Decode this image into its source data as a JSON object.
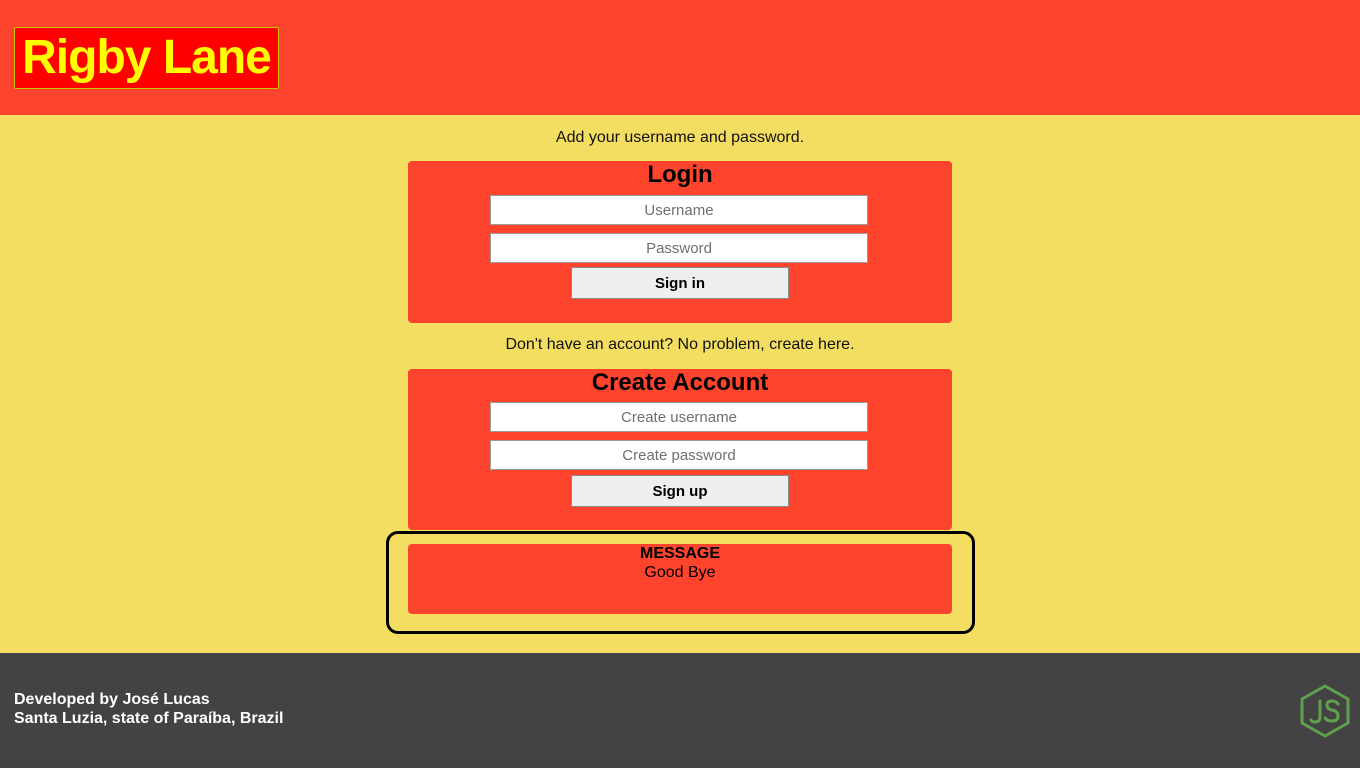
{
  "header": {
    "logo_text": "Rigby Lane"
  },
  "login_intro": "Add your username and password.",
  "login": {
    "title": "Login",
    "username_placeholder": "Username",
    "password_placeholder": "Password",
    "submit_label": "Sign in"
  },
  "create_intro": "Don't have an account? No problem, create here.",
  "create": {
    "title": "Create Account",
    "username_placeholder": "Create username",
    "password_placeholder": "Create password",
    "submit_label": "Sign up"
  },
  "message": {
    "title": "MESSAGE",
    "text": "Good Bye"
  },
  "footer": {
    "line1": "Developed by José Lucas",
    "line2": "Santa Luzia, state of Paraíba, Brazil",
    "icon": "nodejs-icon"
  },
  "colors": {
    "header_bg": "#ff442e",
    "page_bg": "#f4de62",
    "logo_bg": "#ff0000",
    "logo_text": "#ffff00",
    "footer_bg": "#434343",
    "node_green": "#5fa04e"
  }
}
